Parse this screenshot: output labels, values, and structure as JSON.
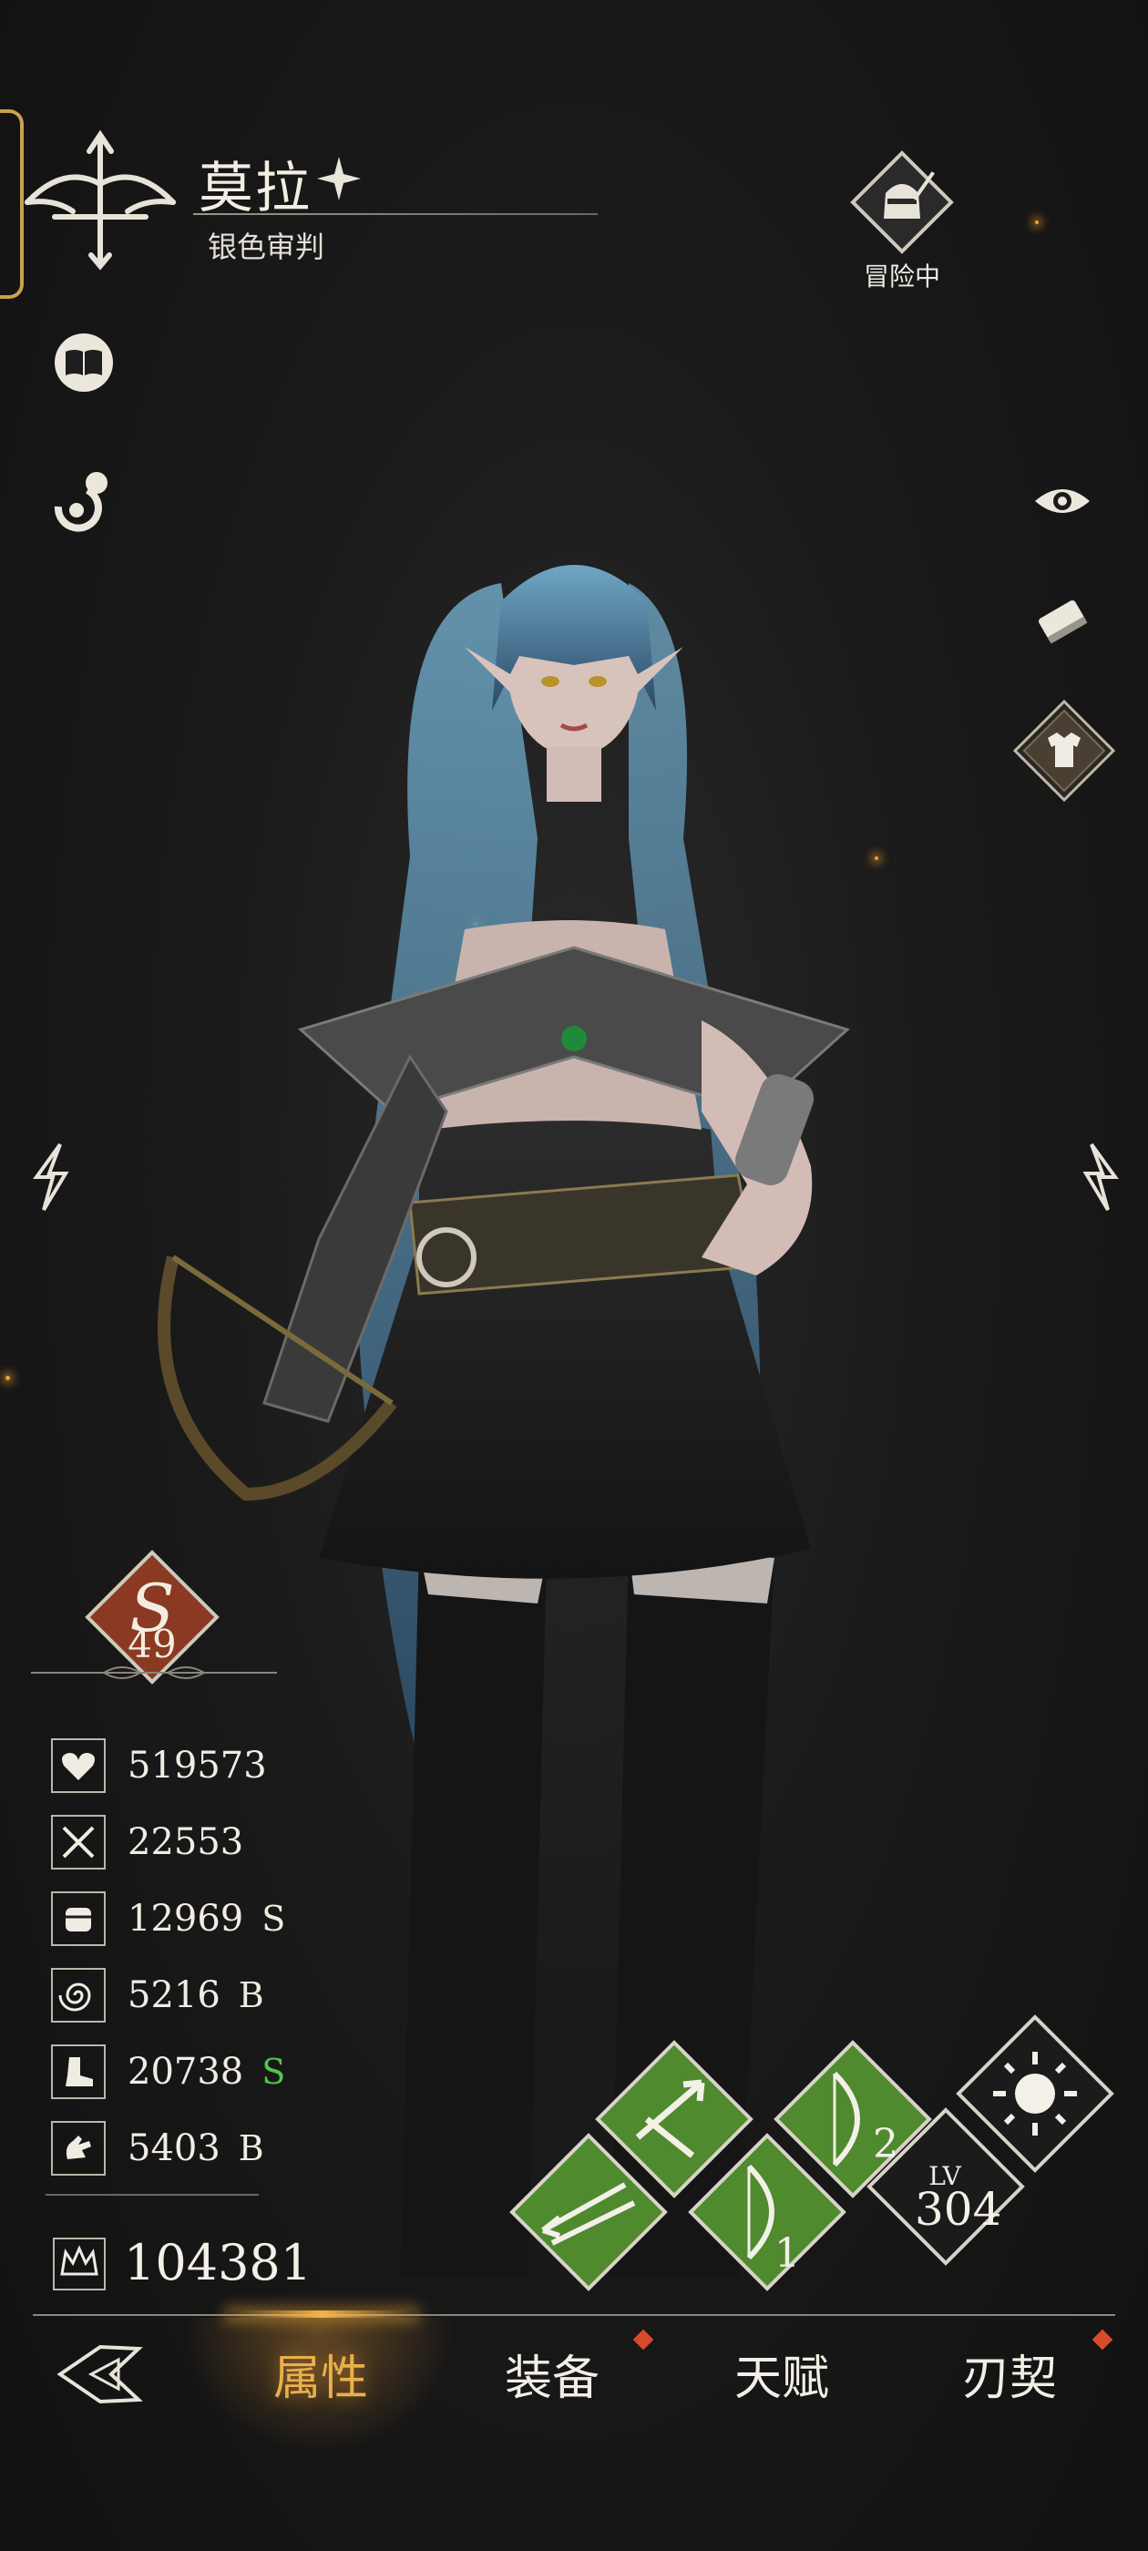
{
  "header": {
    "character_name": "莫拉",
    "character_title": "银色审判",
    "status_label": "冒险中"
  },
  "icons": {
    "class_emblem": "crossbow-emblem-icon",
    "codex": "book-icon",
    "pacifier": "pacifier-icon",
    "eye": "eye-icon",
    "eraser": "eraser-icon",
    "outfit": "shirt-icon",
    "prev": "lightning-left-arrow-icon",
    "next": "lightning-right-arrow-icon"
  },
  "rank": {
    "letter": "S",
    "level": "49",
    "color": "#8a3a22"
  },
  "stats": [
    {
      "icon": "heart-wings-icon",
      "value": "519573",
      "grade": ""
    },
    {
      "icon": "crossed-swords-icon",
      "value": "22553",
      "grade": ""
    },
    {
      "icon": "fist-icon",
      "value": "12969",
      "grade": "S",
      "grade_color": "#f0ebe0"
    },
    {
      "icon": "swirl-icon",
      "value": "5216",
      "grade": "B",
      "grade_color": "#f0ebe0"
    },
    {
      "icon": "boot-icon",
      "value": "20738",
      "grade": "S",
      "grade_color": "#4fc84a"
    },
    {
      "icon": "dodge-hand-icon",
      "value": "5403",
      "grade": "B",
      "grade_color": "#f0ebe0"
    }
  ],
  "power": {
    "icon": "crown-power-icon",
    "value": "104381"
  },
  "skills": [
    {
      "name": "skill-arrow-split",
      "number": ""
    },
    {
      "name": "skill-multi-arrow",
      "number": ""
    },
    {
      "name": "skill-bow-1",
      "number": "1"
    },
    {
      "name": "skill-bow-2",
      "number": "2"
    },
    {
      "name": "skill-sun",
      "number": ""
    }
  ],
  "level": {
    "label": "LV",
    "value": "304"
  },
  "nav": {
    "tabs": [
      "属性",
      "装备",
      "天赋",
      "刃契"
    ],
    "active_index": 0,
    "accent_color": "#e9b04a"
  }
}
